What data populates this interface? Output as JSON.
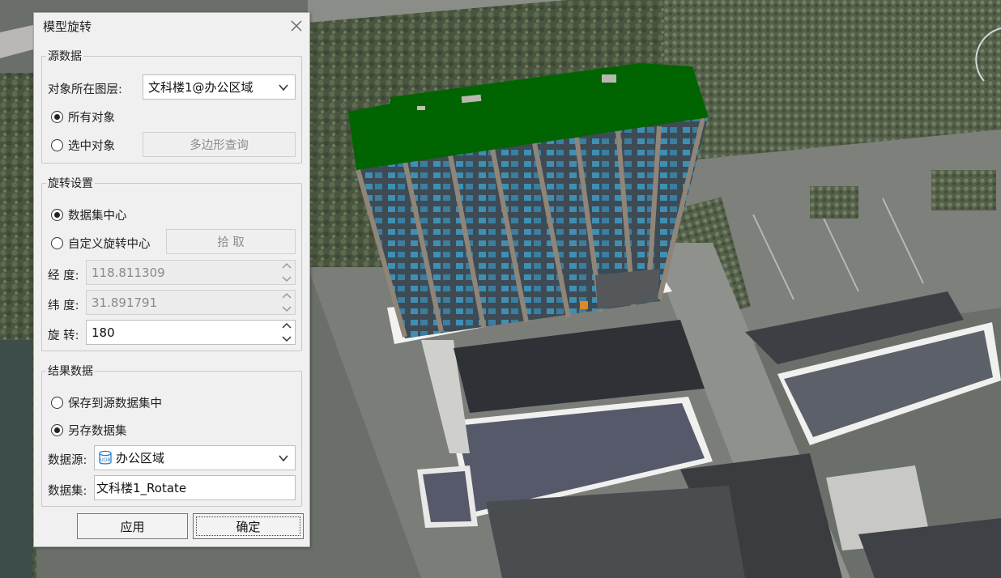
{
  "dialog": {
    "title": "模型旋转",
    "close_icon": "close-icon"
  },
  "source": {
    "legend": "源数据",
    "layer_label": "对象所在图层:",
    "layer_value": "文科楼1@办公区域",
    "all_objects": "所有对象",
    "selected_objects": "选中对象",
    "polygon_query": "多边形查询",
    "selection": "all"
  },
  "rotation": {
    "legend": "旋转设置",
    "dataset_center": "数据集中心",
    "custom_center": "自定义旋转中心",
    "pick": "拾 取",
    "lon_label": "经 度:",
    "lon_value": "118.811309",
    "lat_label": "纬 度:",
    "lat_value": "31.891791",
    "rot_label": "旋 转:",
    "rot_value": "180",
    "center_mode": "dataset"
  },
  "result": {
    "legend": "结果数据",
    "save_to_source": "保存到源数据集中",
    "save_as": "另存数据集",
    "datasource_label": "数据源:",
    "datasource_value": "办公区域",
    "datasource_icon": "udb-datasource-icon",
    "dataset_label": "数据集:",
    "dataset_value": "文科楼1_Rotate",
    "mode": "save_as"
  },
  "buttons": {
    "apply": "应用",
    "ok": "确定"
  },
  "scene": {
    "roof_color": "#006400",
    "facade_color": "#3f5566",
    "window_color": "#3f8fb3"
  }
}
